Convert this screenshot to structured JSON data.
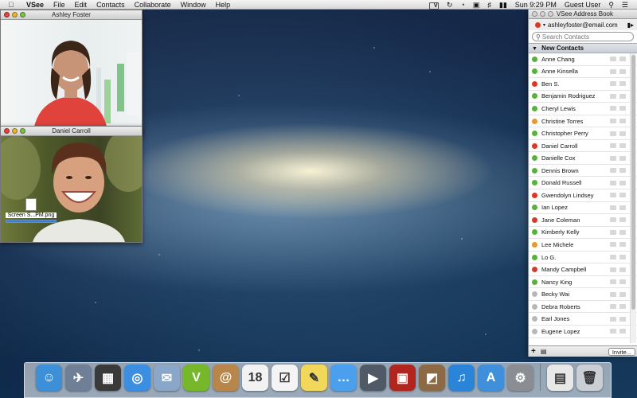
{
  "menubar": {
    "app_name": "VSee",
    "items": [
      "File",
      "Edit",
      "Contacts",
      "Collaborate",
      "Window",
      "Help"
    ],
    "clock": "Sun 9:29 PM",
    "user": "Guest User",
    "vsee_status_letter": "V"
  },
  "video_windows": [
    {
      "title": "Ashley Foster"
    },
    {
      "title": "Daniel Carroll",
      "file_label": "Screen S...PM.png",
      "transfer_progress": 1.0
    }
  ],
  "address_book": {
    "title": "VSee Address Book",
    "account_email": "ashleyfoster@email.com",
    "search_placeholder": "Search Contacts",
    "group_label": "New Contacts",
    "contacts": [
      {
        "name": "Anne Chang",
        "status_color": "#55b23a"
      },
      {
        "name": "Anne Kinsella",
        "status_color": "#55b23a"
      },
      {
        "name": "Ben S.",
        "status_color": "#d63a2a"
      },
      {
        "name": "Benjamin Rodriguez",
        "status_color": "#55b23a"
      },
      {
        "name": "Cheryl Lewis",
        "status_color": "#55b23a"
      },
      {
        "name": "Christine Torres",
        "status_color": "#e8982a"
      },
      {
        "name": "Christopher Perry",
        "status_color": "#55b23a"
      },
      {
        "name": "Daniel Carroll",
        "status_color": "#d63a2a"
      },
      {
        "name": "Danielle Cox",
        "status_color": "#55b23a"
      },
      {
        "name": "Dennis Brown",
        "status_color": "#55b23a"
      },
      {
        "name": "Donald Russell",
        "status_color": "#55b23a"
      },
      {
        "name": "Gwendolyn Lindsey",
        "status_color": "#d63a2a"
      },
      {
        "name": "Ian Lopez",
        "status_color": "#55b23a"
      },
      {
        "name": "Jane Coleman",
        "status_color": "#d63a2a"
      },
      {
        "name": "Kimberly Kelly",
        "status_color": "#55b23a"
      },
      {
        "name": "Lee Michele",
        "status_color": "#e8982a"
      },
      {
        "name": "Lo G.",
        "status_color": "#55b23a"
      },
      {
        "name": "Mandy Campbell",
        "status_color": "#d63a2a"
      },
      {
        "name": "Nancy King",
        "status_color": "#55b23a"
      },
      {
        "name": "Becky Wai",
        "status_color": "#b8b8b8"
      },
      {
        "name": "Debra Roberts",
        "status_color": "#b8b8b8"
      },
      {
        "name": "Earl Jones",
        "status_color": "#b8b8b8"
      },
      {
        "name": "Eugene Lopez",
        "status_color": "#b8b8b8"
      }
    ],
    "invite_label": "Invite...",
    "add_label": "+"
  },
  "dock": {
    "icons": [
      {
        "name": "finder-icon",
        "color": "#3d8fd8",
        "glyph": "☺"
      },
      {
        "name": "launchpad-icon",
        "color": "#6f7f95",
        "glyph": "✈"
      },
      {
        "name": "mission-control-icon",
        "color": "#3a3a3a",
        "glyph": "▦"
      },
      {
        "name": "safari-icon",
        "color": "#3c8ee0",
        "glyph": "◎"
      },
      {
        "name": "mail-icon",
        "color": "#8aa6c8",
        "glyph": "✉"
      },
      {
        "name": "vsee-icon",
        "color": "#76b82a",
        "glyph": "V"
      },
      {
        "name": "contacts-icon",
        "color": "#b8864a",
        "glyph": "@"
      },
      {
        "name": "calendar-icon",
        "color": "#f2f2f2",
        "glyph": "18"
      },
      {
        "name": "reminders-icon",
        "color": "#f4f4f4",
        "glyph": "☑"
      },
      {
        "name": "notes-icon",
        "color": "#f1d75a",
        "glyph": "✎"
      },
      {
        "name": "messages-icon",
        "color": "#4aa0ee",
        "glyph": "…"
      },
      {
        "name": "facetime-icon",
        "color": "#505a66",
        "glyph": "▶"
      },
      {
        "name": "photo-booth-icon",
        "color": "#b0251e",
        "glyph": "▣"
      },
      {
        "name": "iphoto-icon",
        "color": "#8b6a45",
        "glyph": "◩"
      },
      {
        "name": "itunes-icon",
        "color": "#2a84d8",
        "glyph": "♫"
      },
      {
        "name": "app-store-icon",
        "color": "#3f8fdb",
        "glyph": "A"
      },
      {
        "name": "system-preferences-icon",
        "color": "#8a8d92",
        "glyph": "⚙"
      }
    ],
    "trailing_icons": [
      {
        "name": "document-icon",
        "color": "#e8e8e8",
        "glyph": "▤"
      },
      {
        "name": "trash-icon",
        "color": "#c9cfd4",
        "glyph": "🗑"
      }
    ]
  }
}
